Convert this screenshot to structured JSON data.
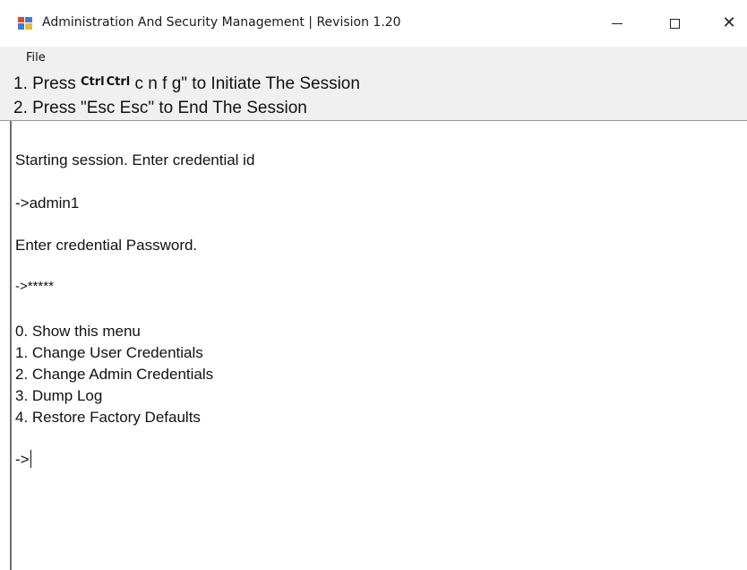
{
  "window": {
    "title": "Administration And Security Management  |  Revision 1.20"
  },
  "menu": {
    "file_label": "File"
  },
  "instructions": {
    "line1_prefix": "1. Press ",
    "line1_key1": "Ctrl",
    "line1_key2": "Ctrl",
    "line1_suffix": " c n f g\" to Initiate The Session",
    "line2": "2. Press \"Esc Esc\" to End The Session"
  },
  "console": {
    "line_start": "Starting session. Enter credential id",
    "line_id_input": "->admin1",
    "line_pw_prompt": "Enter credential Password.",
    "line_pw_input": "->*****",
    "menu_items": [
      "0.  Show this menu",
      "1.  Change User Credentials",
      "2.  Change Admin Credentials",
      "3.  Dump Log",
      "4.  Restore Factory Defaults"
    ],
    "prompt": "->"
  }
}
